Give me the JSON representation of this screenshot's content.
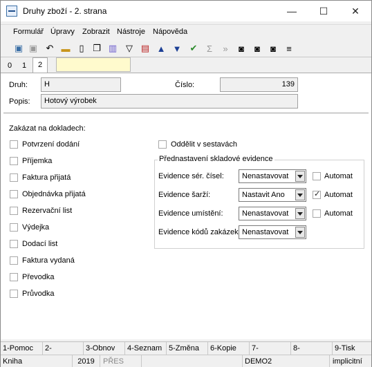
{
  "window": {
    "title": "Druhy zboží - 2. strana"
  },
  "menu": [
    "Formulář",
    "Úpravy",
    "Zobrazit",
    "Nástroje",
    "Nápověda"
  ],
  "tabs": [
    "0",
    "1",
    "2"
  ],
  "form": {
    "druh_label": "Druh:",
    "druh_value": "H",
    "cislo_label": "Číslo:",
    "cislo_value": "139",
    "popis_label": "Popis:",
    "popis_value": "Hotový výrobek"
  },
  "zakazat": {
    "heading": "Zakázat na dokladech:",
    "items": [
      "Potvrzení dodání",
      "Příjemka",
      "Faktura přijatá",
      "Objednávka přijatá",
      "Rezervační list",
      "Výdejka",
      "Dodací list",
      "Faktura vydaná",
      "Převodka",
      "Průvodka"
    ]
  },
  "oddelit_label": "Oddělit v sestavách",
  "evidence": {
    "title": "Přednastavení skladové evidence",
    "rows": [
      {
        "label": "Evidence sér. čísel:",
        "value": "Nenastavovat",
        "automat": "Automat",
        "checked": false
      },
      {
        "label": "Evidence šarží:",
        "value": "Nastavit Ano",
        "automat": "Automat",
        "checked": true
      },
      {
        "label": "Evidence umístění:",
        "value": "Nenastavovat",
        "automat": "Automat",
        "checked": false
      },
      {
        "label": "Evidence kódů zakázek:",
        "value": "Nenastavovat"
      }
    ]
  },
  "fkeys": [
    "1-Pomoc",
    "2-",
    "3-Obnov",
    "4-Seznam",
    "5-Změna",
    "6-Kopie",
    "7-",
    "8-",
    "9-Tisk"
  ],
  "status": {
    "kniha": "Kniha",
    "year": "2019",
    "pres": "PŘES",
    "db": "DEMO2",
    "mode": "implicitní"
  }
}
